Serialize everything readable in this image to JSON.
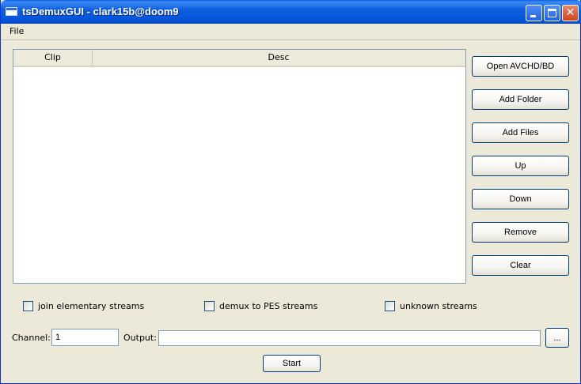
{
  "window": {
    "title": "tsDemuxGUI - clark15b@doom9"
  },
  "menu": {
    "file": "File"
  },
  "list": {
    "columns": [
      "Clip",
      "Desc"
    ]
  },
  "buttons": {
    "open": "Open AVCHD/BD",
    "add_folder": "Add Folder",
    "add_files": "Add Files",
    "up": "Up",
    "down": "Down",
    "remove": "Remove",
    "clear": "Clear",
    "browse": "...",
    "start": "Start"
  },
  "options": {
    "join": "join elementary streams",
    "pes": "demux to PES streams",
    "unknown": "unknown streams"
  },
  "channel": {
    "label": "Channel:",
    "value": "1"
  },
  "output": {
    "label": "Output:",
    "value": ""
  },
  "colors": {
    "titlebar": "#0353d8",
    "window_bg": "#ece9d8",
    "close_button": "#d2431c"
  }
}
